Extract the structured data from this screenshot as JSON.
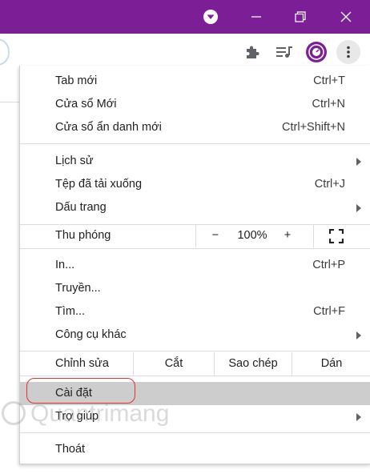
{
  "colors": {
    "titlebar": "#7c1f97",
    "hover_highlight": "#cdcdcd",
    "annotation": "#e03131"
  },
  "titlebar": {
    "icons": [
      "chevron-down-icon",
      "minimize-icon",
      "maximize-icon",
      "close-icon"
    ]
  },
  "toolbar": {
    "icons": [
      "puzzle-icon",
      "media-queue-icon",
      "profile-avatar-icon",
      "more-vert-icon"
    ]
  },
  "menu": {
    "group1": [
      {
        "label": "Tab mới",
        "shortcut": "Ctrl+T"
      },
      {
        "label": "Cửa sổ Mới",
        "shortcut": "Ctrl+N"
      },
      {
        "label": "Cửa sổ ẩn danh mới",
        "shortcut": "Ctrl+Shift+N"
      }
    ],
    "group2": [
      {
        "label": "Lịch sử",
        "has_submenu": true
      },
      {
        "label": "Tệp đã tải xuống",
        "shortcut": "Ctrl+J"
      },
      {
        "label": "Dấu trang",
        "has_submenu": true
      }
    ],
    "zoom": {
      "label": "Thu phóng",
      "minus": "−",
      "value": "100%",
      "plus": "+"
    },
    "group3": [
      {
        "label": "In...",
        "shortcut": "Ctrl+P"
      },
      {
        "label": "Truyền..."
      },
      {
        "label": "Tìm...",
        "shortcut": "Ctrl+F"
      },
      {
        "label": "Công cụ khác",
        "has_submenu": true
      }
    ],
    "edit": {
      "label": "Chỉnh sửa",
      "cut": "Cắt",
      "copy": "Sao chép",
      "paste": "Dán"
    },
    "group4": [
      {
        "label": "Cài đặt",
        "highlighted": true
      },
      {
        "label": "Trợ giúp",
        "has_submenu": true
      }
    ],
    "group5": [
      {
        "label": "Thoát"
      }
    ]
  },
  "watermark": {
    "text": "Quantrimang"
  }
}
